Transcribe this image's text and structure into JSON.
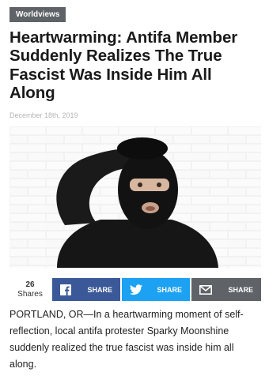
{
  "category": {
    "label": "Worldviews"
  },
  "article": {
    "title": "Heartwarming: Antifa Member Suddenly Realizes The True Fascist Was Inside Him All Along",
    "date": "December 18th, 2019",
    "image_alt": "Person in black balaclava and hoodie scratching head in front of white brick wall",
    "body": "PORTLAND, OR—In a heartwarming moment of self-reflection, local antifa protester Sparky Moonshine suddenly realized the true fascist was inside him all along."
  },
  "share": {
    "count": "26",
    "count_label": "Shares",
    "facebook_label": "SHARE",
    "twitter_label": "SHARE",
    "email_label": "SHARE",
    "icons": {
      "facebook": "facebook-icon",
      "twitter": "twitter-icon",
      "email": "email-icon"
    }
  },
  "colors": {
    "category_bg": "#5f6368",
    "facebook": "#3b5998",
    "twitter": "#1da1f2",
    "email": "#5f6368"
  }
}
